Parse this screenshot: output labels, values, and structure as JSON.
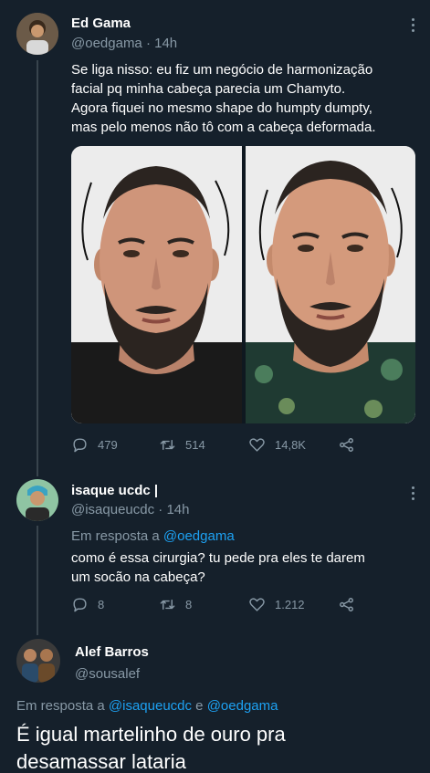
{
  "tweet1": {
    "name": "Ed Gama",
    "handle": "@oedgama",
    "time": "· 14h",
    "text_lines": [
      "Se liga nisso: eu fiz um negócio de harmonização",
      "facial pq minha cabeça parecia um Chamyto.",
      "Agora fiquei no mesmo shape do humpty dumpty,",
      "mas pelo menos não tô com a cabeça deformada."
    ],
    "replies": "479",
    "retweets": "514",
    "likes": "14,8K"
  },
  "tweet2": {
    "name": "isaque ucdc |",
    "handle": "@isaqueucdc",
    "time": "· 14h",
    "reply_prefix": "Em resposta a ",
    "reply_to": "@oedgama",
    "text_lines": [
      "como é essa cirurgia? tu pede pra eles te darem",
      "um socão na cabeça?"
    ],
    "replies": "8",
    "retweets": "8",
    "likes": "1.212"
  },
  "tweet3": {
    "name": "Alef Barros",
    "handle": "@sousalef",
    "reply_prefix": "Em resposta a ",
    "reply_to_1": "@isaqueucdc",
    "reply_join": " e ",
    "reply_to_2": "@oedgama",
    "text_lines": [
      "É igual martelinho de ouro pra",
      "desamassar lataria"
    ]
  },
  "colors": {
    "background": "#15202b",
    "accent": "#1da1f2",
    "muted": "#8899a6"
  },
  "icons": [
    "reply-icon",
    "retweet-icon",
    "like-icon",
    "share-icon",
    "more-icon"
  ]
}
